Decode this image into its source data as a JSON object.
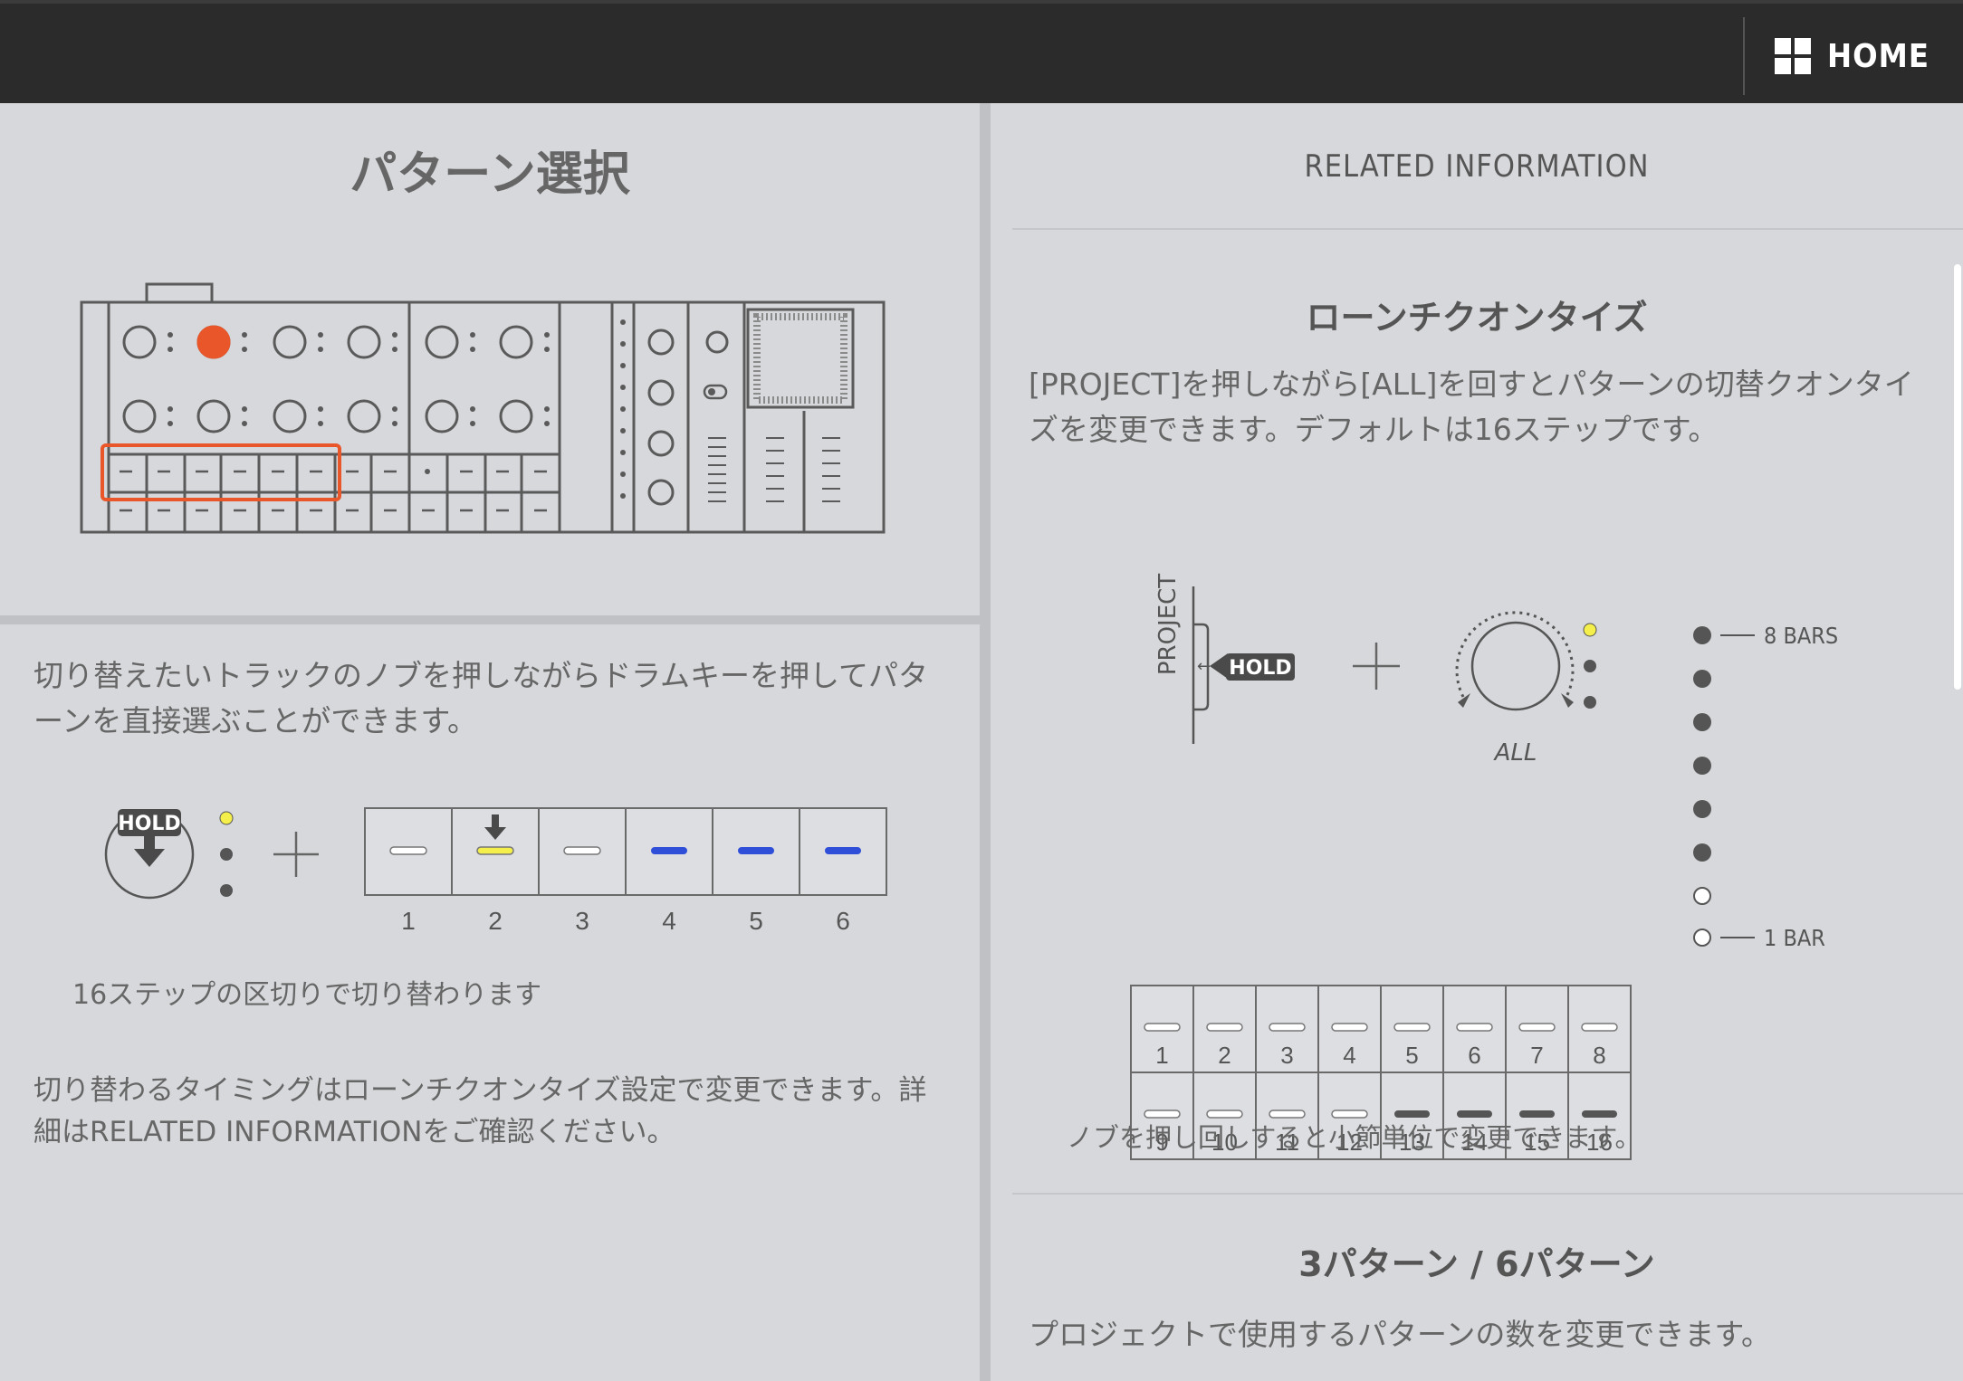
{
  "topbar": {
    "home_label": "HOME",
    "home_icon": "grid-icon"
  },
  "left": {
    "title": "パターン選択",
    "para1": "切り替えたいトラックのノブを押しながらドラムキーを押してパターンを直接選ぶことができます。",
    "hold_label": "HOLD",
    "step_numbers": [
      "1",
      "2",
      "3",
      "4",
      "5",
      "6"
    ],
    "note": "16ステップの区切りで切り替わります",
    "para2": "切り替わるタイミングはローンチクオンタイズ設定で変更できます。詳細はRELATED INFORMATIONをご確認ください。",
    "colors": {
      "accent": "#e8562a",
      "yellow": "#f4ef4a",
      "blue": "#2f4fd8",
      "white": "#ffffff"
    }
  },
  "right": {
    "heading": "RELATED INFORMATION",
    "section1": {
      "title": "ローンチクオンタイズ",
      "text": "[PROJECT]を押しながら[ALL]を回すとパターンの切替クオンタイズを変更できます。デフォルトは16ステップです。",
      "project_label": "PROJECT",
      "hold_label": "HOLD",
      "all_label": "ALL",
      "bars_top": "8 BARS",
      "bars_bottom": "1 BAR",
      "grid_numbers": [
        "1",
        "2",
        "3",
        "4",
        "5",
        "6",
        "7",
        "8",
        "9",
        "10",
        "11",
        "12",
        "13",
        "14",
        "15",
        "16"
      ],
      "note": "ノブを押し回しすると小節単位で変更できます。"
    },
    "section2": {
      "title": "3パターン / 6パターン",
      "text": "プロジェクトで使用するパターンの数を変更できます。"
    }
  }
}
